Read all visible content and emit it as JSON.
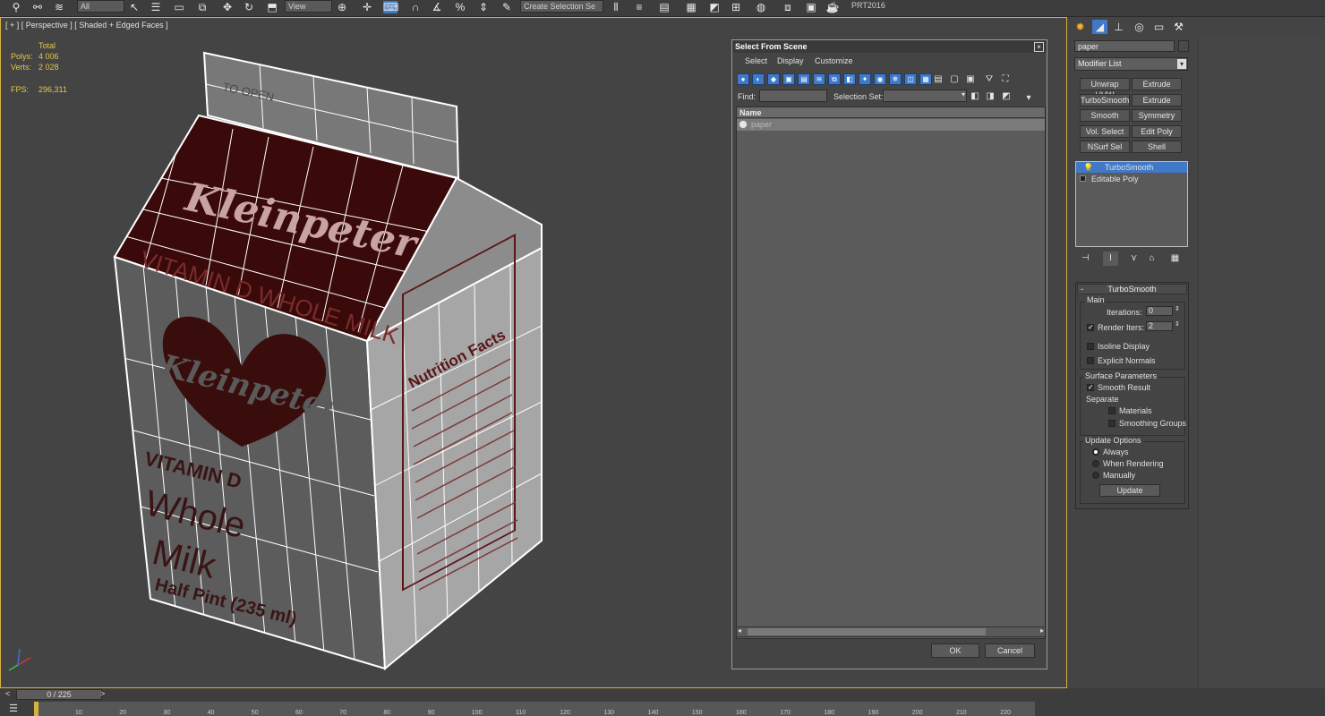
{
  "toolbar": {
    "dropdown1": "All",
    "dropdown2": "View",
    "selection_set": "Create Selection Se",
    "project": "PRT2016"
  },
  "viewport": {
    "label": "[ + ] [ Perspective ] [ Shaded + Edged Faces ]",
    "stats": {
      "total_label": "Total",
      "polys_label": "Polys:",
      "polys_value": "4 006",
      "verts_label": "Verts:",
      "verts_value": "2 028",
      "fps_label": "FPS:",
      "fps_value": "296,311"
    },
    "carton_text": {
      "brand": "Kleinpeter",
      "band": "VITAMIN D WHOLE MILK",
      "line1": "VITAMIN D",
      "line2": "Whole",
      "line3": "Milk",
      "line4": "Half Pint (235 ml)",
      "nutrition": "Nutrition Facts",
      "open": "TO OPEN"
    }
  },
  "dialog": {
    "title": "Select From Scene",
    "menu": [
      "Select",
      "Display",
      "Customize"
    ],
    "find_label": "Find:",
    "selection_set_label": "Selection Set:",
    "column_name": "Name",
    "rows": [
      "paper"
    ],
    "ok": "OK",
    "cancel": "Cancel"
  },
  "command_panel": {
    "object_name": "paper",
    "modifier_list": "Modifier List",
    "modifier_buttons": [
      "Unwrap UVW",
      "Extrude",
      "TurboSmooth",
      "Extrude",
      "Smooth",
      "Symmetry",
      "Vol. Select",
      "Edit Poly",
      "NSurf Sel",
      "Shell"
    ],
    "stack": [
      "TurboSmooth",
      "Editable Poly"
    ],
    "rollout_title": "TurboSmooth",
    "main_label": "Main",
    "iterations_label": "Iterations:",
    "iterations_value": "0",
    "render_iters_label": "Render Iters:",
    "render_iters_value": "2",
    "isoline_display": "Isoline Display",
    "explicit_normals": "Explicit Normals",
    "surface_params": "Surface Parameters",
    "smooth_result": "Smooth Result",
    "separate": "Separate",
    "materials": "Materials",
    "smoothing_groups": "Smoothing Groups",
    "update_options": "Update Options",
    "always": "Always",
    "when_rendering": "When Rendering",
    "manually": "Manually",
    "update": "Update"
  },
  "timeline": {
    "slider": "0 / 225",
    "ticks": [
      "10",
      "20",
      "30",
      "40",
      "50",
      "60",
      "70",
      "80",
      "90",
      "100",
      "110",
      "120",
      "130",
      "140",
      "150",
      "160",
      "170",
      "180",
      "190",
      "200",
      "210",
      "220"
    ]
  }
}
